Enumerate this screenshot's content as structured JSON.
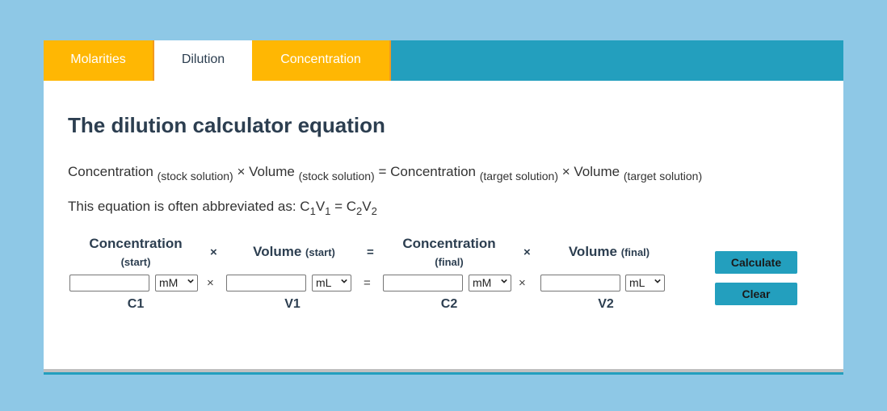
{
  "tabs": [
    {
      "label": "Molarities",
      "active": false
    },
    {
      "label": "Dilution",
      "active": true
    },
    {
      "label": "Concentration",
      "active": false
    }
  ],
  "heading": "The dilution calculator equation",
  "equation": {
    "c_stock": "Concentration",
    "c_stock_sub": "(stock solution)",
    "times1": "×",
    "v_stock": "Volume",
    "v_stock_sub": "(stock solution)",
    "equals": "=",
    "c_target": "Concentration",
    "c_target_sub": "(target solution)",
    "times2": "×",
    "v_target": "Volume",
    "v_target_sub": "(target solution)"
  },
  "abbreviation": {
    "prefix": "This equation is often abbreviated as: ",
    "c1": "C",
    "c1_sub": "1",
    "v1": "V",
    "v1_sub": "1",
    "eq": " = ",
    "c2": "C",
    "c2_sub": "2",
    "v2": "V",
    "v2_sub": "2"
  },
  "calculator": {
    "headers": {
      "c_start": "Concentration",
      "c_start_sub": "(start)",
      "v_start": "Volume",
      "v_start_sub": "(start)",
      "c_final": "Concentration",
      "c_final_sub": "(final)",
      "v_final": "Volume",
      "v_final_sub": "(final)",
      "times": "×",
      "equals": "="
    },
    "fields": [
      {
        "id": "C1",
        "value": "",
        "unit": "mM"
      },
      {
        "id": "V1",
        "value": "",
        "unit": "mL"
      },
      {
        "id": "C2",
        "value": "",
        "unit": "mM"
      },
      {
        "id": "V2",
        "value": "",
        "unit": "mL"
      }
    ],
    "row_ops": {
      "times": "×",
      "equals": "="
    },
    "calculate_label": "Calculate",
    "clear_label": "Clear"
  }
}
